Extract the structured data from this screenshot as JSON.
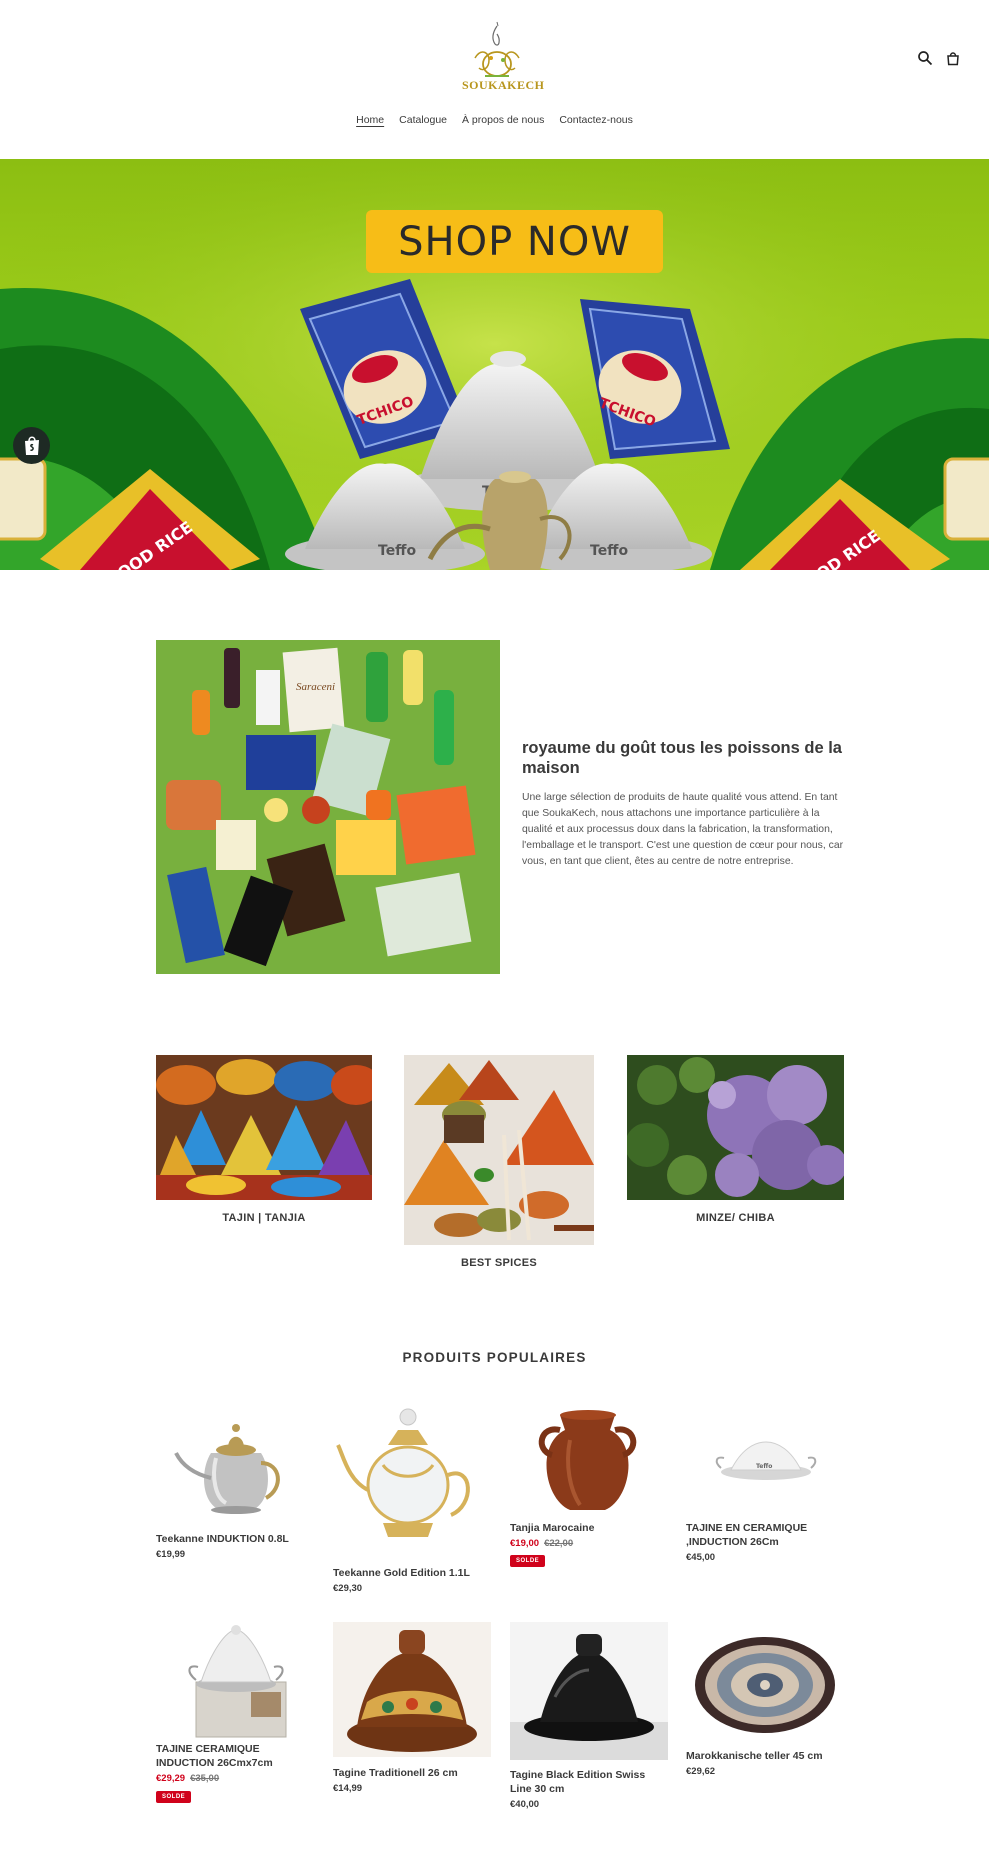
{
  "brand": {
    "logo_text": "SOUKAKECH"
  },
  "nav": [
    {
      "label": "Home",
      "active": true
    },
    {
      "label": "Catalogue"
    },
    {
      "label": "À propos de nous"
    },
    {
      "label": "Contactez-nous"
    }
  ],
  "header_icons": [
    "search-icon",
    "cart-icon"
  ],
  "hero": {
    "button_label": "SHOP NOW",
    "product_texts": {
      "rice_brand": "TCHICO",
      "rice_type": "GOOD RICE",
      "tagine_brand": "Teffo"
    },
    "colors": {
      "sky": "#9ccc1a",
      "hill": "#107a16",
      "button": "#f7bd17"
    }
  },
  "image_with_text": {
    "image_label": "Saraceni",
    "title": "royaume du goût tous les poissons de la maison",
    "body": "Une large sélection de produits de haute qualité vous attend. En tant que SoukaKech, nous attachons une importance particulière à la qualité et aux processus doux dans la fabrication, la transformation, l'emballage et le transport. C'est une question de cœur pour nous, car vous, en tant que client, êtes au centre de notre entreprise."
  },
  "collections": [
    {
      "label": "TAJIN | TANJIA"
    },
    {
      "label": "BEST SPICES"
    },
    {
      "label": "MINZE/ CHIBA"
    }
  ],
  "products": {
    "title": "PRODUITS POPULAIRES",
    "items": [
      {
        "title": "Teekanne INDUKTION 0.8L",
        "price": "€19,99"
      },
      {
        "title": "Teekanne Gold Edition 1.1L",
        "price": "€29,30"
      },
      {
        "title": "Tanjia Marocaine",
        "price": "€19,00",
        "compare": "€22,00",
        "badge": "SOLDE"
      },
      {
        "title": "TAJINE EN CERAMIQUE ,INDUCTION 26Cm",
        "price": "€45,00"
      },
      {
        "title": "TAJINE CERAMIQUE INDUCTION 26Cmx7cm",
        "price": "€29,29",
        "compare": "€35,00",
        "badge": "SOLDE"
      },
      {
        "title": "Tagine Traditionell 26 cm",
        "price": "€14,99"
      },
      {
        "title": "Tagine Black Edition Swiss Line 30 cm",
        "price": "€40,00"
      },
      {
        "title": "Marokkanische teller 45 cm",
        "price": "€29,62"
      }
    ],
    "image_brand": "Teffo"
  }
}
